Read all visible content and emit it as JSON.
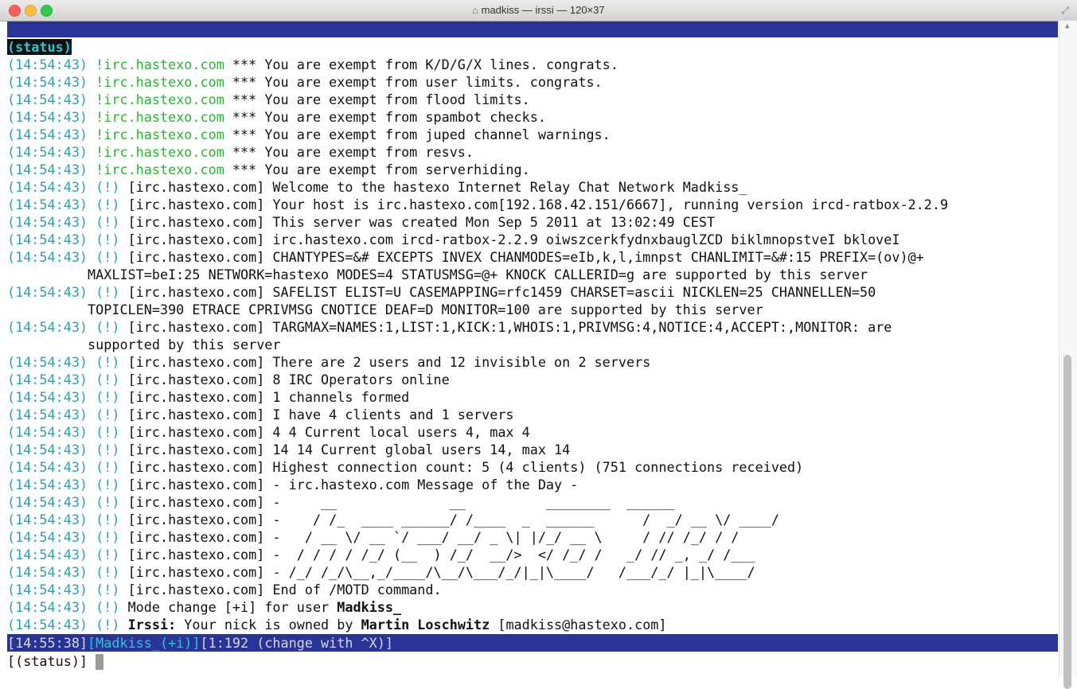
{
  "window": {
    "title": "madkiss — irssi — 120×37",
    "home_icon": "home-icon",
    "fullscreen_icon": "fullscreen-icon"
  },
  "window_label": "(status)",
  "messages": [
    {
      "ts": "(14:54:43)",
      "src": "!irc.hastexo.com",
      "text": " *** You are exempt from K/D/G/X lines. congrats."
    },
    {
      "ts": "(14:54:43)",
      "src": "!irc.hastexo.com",
      "text": " *** You are exempt from user limits. congrats."
    },
    {
      "ts": "(14:54:43)",
      "src": "!irc.hastexo.com",
      "text": " *** You are exempt from flood limits."
    },
    {
      "ts": "(14:54:43)",
      "src": "!irc.hastexo.com",
      "text": " *** You are exempt from spambot checks."
    },
    {
      "ts": "(14:54:43)",
      "src": "!irc.hastexo.com",
      "text": " *** You are exempt from juped channel warnings."
    },
    {
      "ts": "(14:54:43)",
      "src": "!irc.hastexo.com",
      "text": " *** You are exempt from resvs."
    },
    {
      "ts": "(14:54:43)",
      "src": "!irc.hastexo.com",
      "text": " *** You are exempt from serverhiding."
    }
  ],
  "server_lines": [
    {
      "ts": "(14:54:43)",
      "bang": "(!)",
      "text": " [irc.hastexo.com] Welcome to the hastexo Internet Relay Chat Network Madkiss_"
    },
    {
      "ts": "(14:54:43)",
      "bang": "(!)",
      "text": " [irc.hastexo.com] Your host is irc.hastexo.com[192.168.42.151/6667], running version ircd-ratbox-2.2.9"
    },
    {
      "ts": "(14:54:43)",
      "bang": "(!)",
      "text": " [irc.hastexo.com] This server was created Mon Sep 5 2011 at 13:02:49 CEST"
    },
    {
      "ts": "(14:54:43)",
      "bang": "(!)",
      "text": " [irc.hastexo.com] irc.hastexo.com ircd-ratbox-2.2.9 oiwszcerkfydnxbauglZCD biklmnopstveI bkloveI"
    },
    {
      "ts": "(14:54:43)",
      "bang": "(!)",
      "text": " [irc.hastexo.com] CHANTYPES=&# EXCEPTS INVEX CHANMODES=eIb,k,l,imnpst CHANLIMIT=&#:15 PREFIX=(ov)@+"
    },
    {
      "ts": "",
      "bang": "",
      "text": "          MAXLIST=beI:25 NETWORK=hastexo MODES=4 STATUSMSG=@+ KNOCK CALLERID=g are supported by this server"
    },
    {
      "ts": "(14:54:43)",
      "bang": "(!)",
      "text": " [irc.hastexo.com] SAFELIST ELIST=U CASEMAPPING=rfc1459 CHARSET=ascii NICKLEN=25 CHANNELLEN=50"
    },
    {
      "ts": "",
      "bang": "",
      "text": "          TOPICLEN=390 ETRACE CPRIVMSG CNOTICE DEAF=D MONITOR=100 are supported by this server"
    },
    {
      "ts": "(14:54:43)",
      "bang": "(!)",
      "text": " [irc.hastexo.com] TARGMAX=NAMES:1,LIST:1,KICK:1,WHOIS:1,PRIVMSG:4,NOTICE:4,ACCEPT:,MONITOR: are"
    },
    {
      "ts": "",
      "bang": "",
      "text": "          supported by this server"
    },
    {
      "ts": "(14:54:43)",
      "bang": "(!)",
      "text": " [irc.hastexo.com] There are 2 users and 12 invisible on 2 servers"
    },
    {
      "ts": "(14:54:43)",
      "bang": "(!)",
      "text": " [irc.hastexo.com] 8 IRC Operators online"
    },
    {
      "ts": "(14:54:43)",
      "bang": "(!)",
      "text": " [irc.hastexo.com] 1 channels formed"
    },
    {
      "ts": "(14:54:43)",
      "bang": "(!)",
      "text": " [irc.hastexo.com] I have 4 clients and 1 servers"
    },
    {
      "ts": "(14:54:43)",
      "bang": "(!)",
      "text": " [irc.hastexo.com] 4 4 Current local users 4, max 4"
    },
    {
      "ts": "(14:54:43)",
      "bang": "(!)",
      "text": " [irc.hastexo.com] 14 14 Current global users 14, max 14"
    },
    {
      "ts": "(14:54:43)",
      "bang": "(!)",
      "text": " [irc.hastexo.com] Highest connection count: 5 (4 clients) (751 connections received)"
    },
    {
      "ts": "(14:54:43)",
      "bang": "(!)",
      "text": " [irc.hastexo.com] - irc.hastexo.com Message of the Day -"
    },
    {
      "ts": "(14:54:43)",
      "bang": "(!)",
      "text": " [irc.hastexo.com] -     __              __          ________  ______"
    },
    {
      "ts": "(14:54:43)",
      "bang": "(!)",
      "text": " [irc.hastexo.com] -    / /_  ____ ______/ /____  _  ______      /  _/ __ \\/ ____/"
    },
    {
      "ts": "(14:54:43)",
      "bang": "(!)",
      "text": " [irc.hastexo.com] -   / __ \\/ __ `/ ___/ __/ _ \\| |/_/ __ \\     / // /_/ / /"
    },
    {
      "ts": "(14:54:43)",
      "bang": "(!)",
      "text": " [irc.hastexo.com] -  / / / / /_/ (__  ) /_/  __/>  </ /_/ /   _/ // _, _/ /___"
    },
    {
      "ts": "(14:54:43)",
      "bang": "(!)",
      "text": " [irc.hastexo.com] - /_/ /_/\\__,_/____/\\__/\\___/_/|_|\\____/   /___/_/ |_|\\____/"
    },
    {
      "ts": "(14:54:43)",
      "bang": "(!)",
      "text": " [irc.hastexo.com] End of /MOTD command."
    }
  ],
  "mode_line": {
    "ts": "(14:54:43)",
    "bang": "(!)",
    "pre": " Mode change [+i] for user ",
    "nick": "Madkiss_"
  },
  "nick_line": {
    "ts": "(14:54:43)",
    "bang": "(!)",
    "irssi": " Irssi:",
    "mid": " Your nick is owned by ",
    "owner": "Martin Loschwitz",
    "post": " [madkiss@hastexo.com]"
  },
  "statusbar": {
    "time": "[14:55:38]",
    "nick": "[Madkiss_(+i)]",
    "window": "[1:192 (change with ^X)]"
  },
  "prompt": "[(status)] "
}
